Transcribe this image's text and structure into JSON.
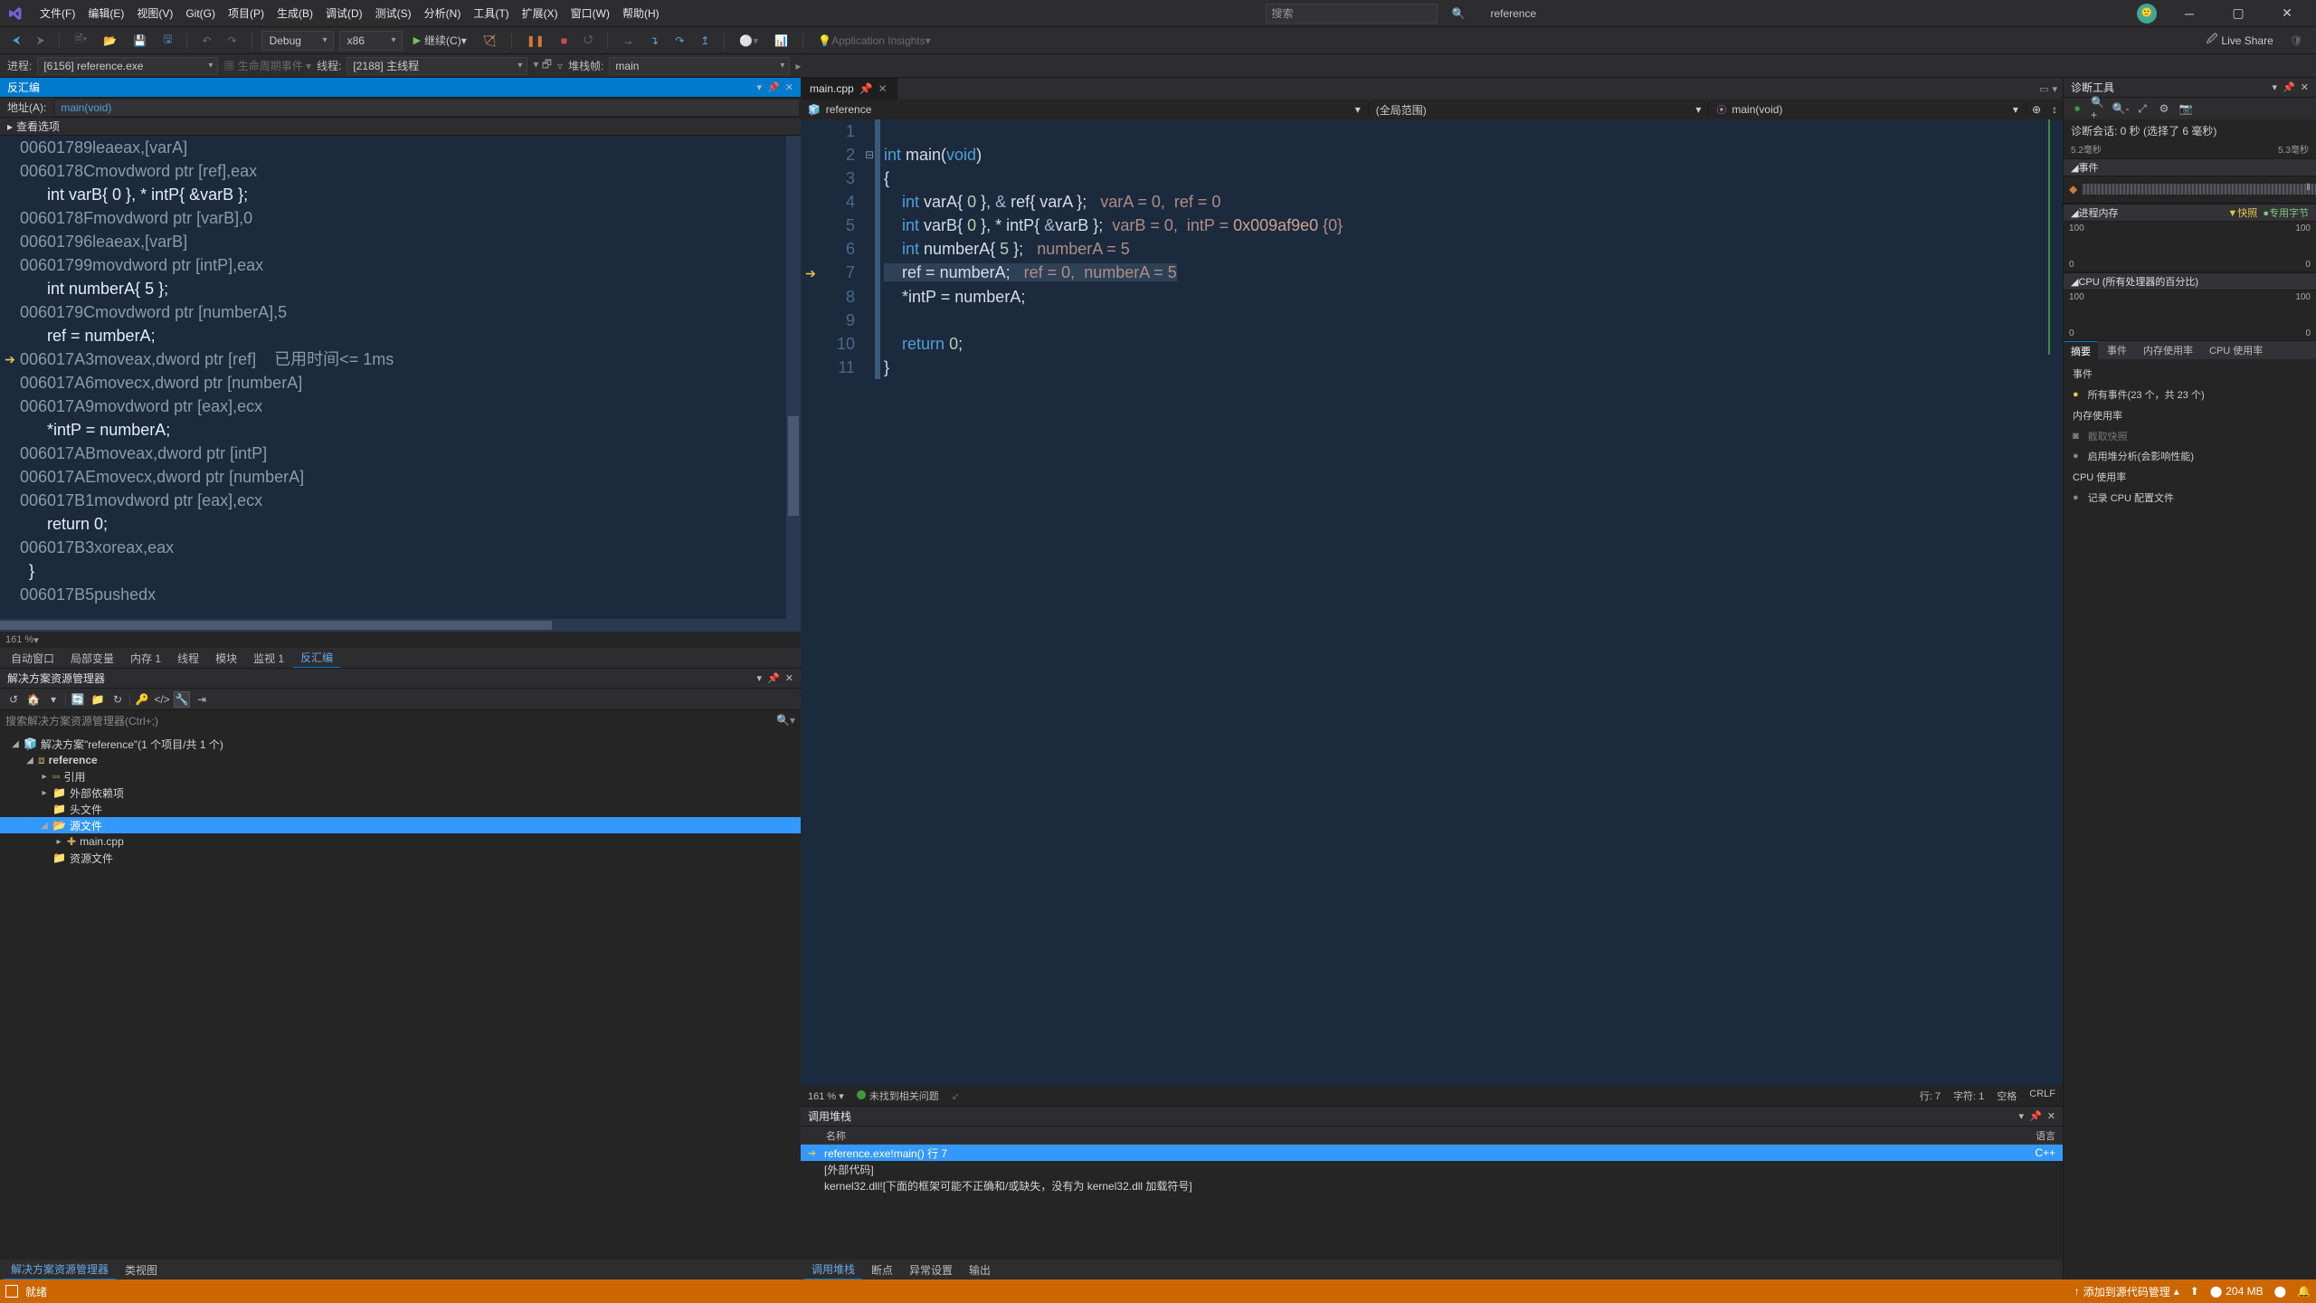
{
  "menu": {
    "file": "文件(F)",
    "edit": "编辑(E)",
    "view": "视图(V)",
    "git": "Git(G)",
    "project": "项目(P)",
    "build": "生成(B)",
    "debug": "调试(D)",
    "test": "测试(S)",
    "analyze": "分析(N)",
    "tools": "工具(T)",
    "extensions": "扩展(X)",
    "window": "窗口(W)",
    "help": "帮助(H)"
  },
  "search_placeholder": "搜索",
  "solution_name": "reference",
  "toolbar": {
    "config": "Debug",
    "platform": "x86",
    "continue": "继续(C)",
    "insights": "Application Insights",
    "live_share": "Live Share"
  },
  "debugbar": {
    "process_lbl": "进程:",
    "process": "[6156] reference.exe",
    "events": "生命周期事件",
    "thread_lbl": "线程:",
    "thread": "[2188] 主线程",
    "stack_lbl": "堆栈帧:",
    "stack": "main"
  },
  "disasm": {
    "title": "反汇编",
    "addr_lbl": "地址(A):",
    "addr_val": "main(void)",
    "opt": "查看选项",
    "zoom": "161 %",
    "lines": [
      {
        "t": "asm",
        "addr": "00601789",
        "op": "lea",
        "args": "eax,[varA]"
      },
      {
        "t": "asm",
        "addr": "0060178C",
        "op": "mov",
        "args": "dword ptr [ref],eax"
      },
      {
        "t": "src",
        "text": "    int varB{ 0 }, * intP{ &varB };"
      },
      {
        "t": "asm",
        "addr": "0060178F",
        "op": "mov",
        "args": "dword ptr [varB],0"
      },
      {
        "t": "asm",
        "addr": "00601796",
        "op": "lea",
        "args": "eax,[varB]"
      },
      {
        "t": "asm",
        "addr": "00601799",
        "op": "mov",
        "args": "dword ptr [intP],eax"
      },
      {
        "t": "src",
        "text": "    int numberA{ 5 };"
      },
      {
        "t": "asm",
        "addr": "0060179C",
        "op": "mov",
        "args": "dword ptr [numberA],5"
      },
      {
        "t": "src",
        "text": "    ref = numberA;"
      },
      {
        "t": "asm",
        "addr": "006017A3",
        "op": "mov",
        "args": "eax,dword ptr [ref]",
        "gutter": "cur",
        "comment": "已用时间<= 1ms"
      },
      {
        "t": "asm",
        "addr": "006017A6",
        "op": "mov",
        "args": "ecx,dword ptr [numberA]"
      },
      {
        "t": "asm",
        "addr": "006017A9",
        "op": "mov",
        "args": "dword ptr [eax],ecx"
      },
      {
        "t": "src",
        "text": "    *intP = numberA;"
      },
      {
        "t": "asm",
        "addr": "006017AB",
        "op": "mov",
        "args": "eax,dword ptr [intP]"
      },
      {
        "t": "asm",
        "addr": "006017AE",
        "op": "mov",
        "args": "ecx,dword ptr [numberA]"
      },
      {
        "t": "asm",
        "addr": "006017B1",
        "op": "mov",
        "args": "dword ptr [eax],ecx"
      },
      {
        "t": "src",
        "text": ""
      },
      {
        "t": "src",
        "text": "    return 0;"
      },
      {
        "t": "asm",
        "addr": "006017B3",
        "op": "xor",
        "args": "eax,eax"
      },
      {
        "t": "src",
        "text": "}"
      },
      {
        "t": "asm",
        "addr": "006017B5",
        "op": "push",
        "args": "edx"
      }
    ]
  },
  "btabs": [
    "自动窗口",
    "局部变量",
    "内存 1",
    "线程",
    "模块",
    "监视 1",
    "反汇编"
  ],
  "btabs_active": 6,
  "sln": {
    "title": "解决方案资源管理器",
    "search": "搜索解决方案资源管理器(Ctrl+;)",
    "root": "解决方案\"reference\"(1 个项目/共 1 个)",
    "project": "reference",
    "nodes": [
      "引用",
      "外部依赖项",
      "头文件",
      "源文件",
      "资源文件"
    ],
    "src_file": "main.cpp",
    "bottom": [
      "解决方案资源管理器",
      "类视图"
    ]
  },
  "editor": {
    "tab": "main.cpp",
    "nav_proj": "reference",
    "nav_scope": "(全局范围)",
    "nav_member": "main(void)",
    "zoom": "161 %",
    "no_issues": "未找到相关问题",
    "pos": "行: 7",
    "char": "字符: 1",
    "space": "空格",
    "crlf": "CRLF",
    "code": [
      {
        "n": 1,
        "html": "",
        "fold": ""
      },
      {
        "n": 2,
        "html": "<span class='kw'>int</span> <span class='id'>main</span><span class='pn'>(</span><span class='kw'>void</span><span class='pn'>)</span>",
        "fold": "⊟"
      },
      {
        "n": 3,
        "html": "<span class='pn'>{</span>"
      },
      {
        "n": 4,
        "html": "    <span class='kw'>int</span> <span class='id'>varA</span><span class='pn'>{</span> <span class='nm'>0</span> <span class='pn'>}, </span><span class='amp'>&amp;</span> <span class='id'>ref</span><span class='pn'>{</span> <span class='id'>varA</span> <span class='pn'>};</span>   <span class='watch'>varA = 0,  ref = 0</span>"
      },
      {
        "n": 5,
        "html": "    <span class='kw'>int</span> <span class='id'>varB</span><span class='pn'>{</span> <span class='nm'>0</span> <span class='pn'>}, *</span> <span class='id'>intP</span><span class='pn'>{</span> <span class='amp'>&amp;</span><span class='id'>varB</span> <span class='pn'>};</span>  <span class='watch'>varB = 0,  intP = <span class='hex'>0x009af9e0</span> {0}</span>"
      },
      {
        "n": 6,
        "html": "    <span class='kw'>int</span> <span class='id'>numberA</span><span class='pn'>{</span> <span class='nm'>5</span> <span class='pn'>};</span>   <span class='watch'>numberA = 5</span>"
      },
      {
        "n": 7,
        "html": "    <span class='id'>ref</span> <span class='pn'>=</span> <span class='id'>numberA</span><span class='pn'>;</span>   <span class='watch'>ref = 0,  numberA = 5</span>",
        "cur": true,
        "gutter": "◆"
      },
      {
        "n": 8,
        "html": "    <span class='pn'>*</span><span class='id'>intP</span> <span class='pn'>=</span> <span class='id'>numberA</span><span class='pn'>;</span>"
      },
      {
        "n": 9,
        "html": ""
      },
      {
        "n": 10,
        "html": "    <span class='kw'>return</span> <span class='nm'>0</span><span class='pn'>;</span>"
      },
      {
        "n": 11,
        "html": "<span class='pn'>}</span>"
      }
    ]
  },
  "callstack": {
    "title": "调用堆栈",
    "col_name": "名称",
    "col_lang": "语言",
    "rows": [
      {
        "sel": true,
        "arrow": true,
        "text": "reference.exe!main() 行 7",
        "lang": "C++"
      },
      {
        "text": "[外部代码]"
      },
      {
        "text": "kernel32.dll![下面的框架可能不正确和/或缺失，没有为 kernel32.dll 加载符号]"
      }
    ],
    "bottom": [
      "调用堆栈",
      "断点",
      "异常设置",
      "输出"
    ]
  },
  "diag": {
    "title": "诊断工具",
    "session": "诊断会话: 0 秒 (选择了 6 毫秒)",
    "t_left": "5.2毫秒",
    "t_right": "5.3毫秒",
    "s_events": "事件",
    "s_mem": "进程内存",
    "mem_quick": "▼快照",
    "mem_priv": "●专用字节",
    "mem_top": "100",
    "mem_bot": "0",
    "s_cpu": "CPU (所有处理器的百分比)",
    "cpu_top": "100",
    "cpu_bot": "0",
    "tabs": [
      "摘要",
      "事件",
      "内存使用率",
      "CPU 使用率"
    ],
    "b_events": "事件",
    "b_events_item": "所有事件(23 个，共 23 个)",
    "b_mem": "内存使用率",
    "b_mem_snap": "截取快照",
    "b_mem_heap": "启用堆分析(会影响性能)",
    "b_cpu": "CPU 使用率",
    "b_cpu_rec": "记录 CPU 配置文件"
  },
  "status": {
    "ready": "就绪",
    "add_src": "添加到源代码管理",
    "mem": "204 MB"
  }
}
